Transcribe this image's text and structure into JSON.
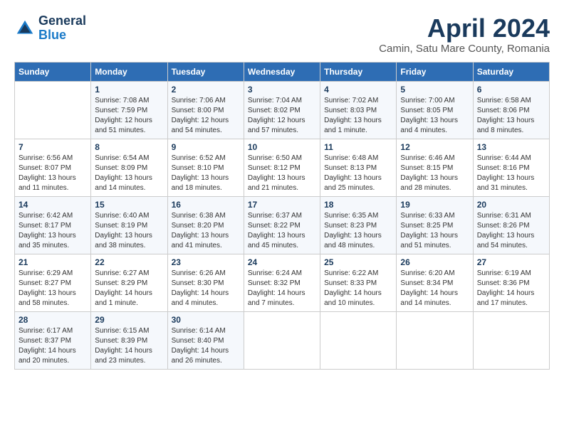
{
  "header": {
    "logo_general": "General",
    "logo_blue": "Blue",
    "month_title": "April 2024",
    "location": "Camin, Satu Mare County, Romania"
  },
  "weekdays": [
    "Sunday",
    "Monday",
    "Tuesday",
    "Wednesday",
    "Thursday",
    "Friday",
    "Saturday"
  ],
  "weeks": [
    [
      {
        "day": "",
        "sunrise": "",
        "sunset": "",
        "daylight": ""
      },
      {
        "day": "1",
        "sunrise": "Sunrise: 7:08 AM",
        "sunset": "Sunset: 7:59 PM",
        "daylight": "Daylight: 12 hours and 51 minutes."
      },
      {
        "day": "2",
        "sunrise": "Sunrise: 7:06 AM",
        "sunset": "Sunset: 8:00 PM",
        "daylight": "Daylight: 12 hours and 54 minutes."
      },
      {
        "day": "3",
        "sunrise": "Sunrise: 7:04 AM",
        "sunset": "Sunset: 8:02 PM",
        "daylight": "Daylight: 12 hours and 57 minutes."
      },
      {
        "day": "4",
        "sunrise": "Sunrise: 7:02 AM",
        "sunset": "Sunset: 8:03 PM",
        "daylight": "Daylight: 13 hours and 1 minute."
      },
      {
        "day": "5",
        "sunrise": "Sunrise: 7:00 AM",
        "sunset": "Sunset: 8:05 PM",
        "daylight": "Daylight: 13 hours and 4 minutes."
      },
      {
        "day": "6",
        "sunrise": "Sunrise: 6:58 AM",
        "sunset": "Sunset: 8:06 PM",
        "daylight": "Daylight: 13 hours and 8 minutes."
      }
    ],
    [
      {
        "day": "7",
        "sunrise": "Sunrise: 6:56 AM",
        "sunset": "Sunset: 8:07 PM",
        "daylight": "Daylight: 13 hours and 11 minutes."
      },
      {
        "day": "8",
        "sunrise": "Sunrise: 6:54 AM",
        "sunset": "Sunset: 8:09 PM",
        "daylight": "Daylight: 13 hours and 14 minutes."
      },
      {
        "day": "9",
        "sunrise": "Sunrise: 6:52 AM",
        "sunset": "Sunset: 8:10 PM",
        "daylight": "Daylight: 13 hours and 18 minutes."
      },
      {
        "day": "10",
        "sunrise": "Sunrise: 6:50 AM",
        "sunset": "Sunset: 8:12 PM",
        "daylight": "Daylight: 13 hours and 21 minutes."
      },
      {
        "day": "11",
        "sunrise": "Sunrise: 6:48 AM",
        "sunset": "Sunset: 8:13 PM",
        "daylight": "Daylight: 13 hours and 25 minutes."
      },
      {
        "day": "12",
        "sunrise": "Sunrise: 6:46 AM",
        "sunset": "Sunset: 8:15 PM",
        "daylight": "Daylight: 13 hours and 28 minutes."
      },
      {
        "day": "13",
        "sunrise": "Sunrise: 6:44 AM",
        "sunset": "Sunset: 8:16 PM",
        "daylight": "Daylight: 13 hours and 31 minutes."
      }
    ],
    [
      {
        "day": "14",
        "sunrise": "Sunrise: 6:42 AM",
        "sunset": "Sunset: 8:17 PM",
        "daylight": "Daylight: 13 hours and 35 minutes."
      },
      {
        "day": "15",
        "sunrise": "Sunrise: 6:40 AM",
        "sunset": "Sunset: 8:19 PM",
        "daylight": "Daylight: 13 hours and 38 minutes."
      },
      {
        "day": "16",
        "sunrise": "Sunrise: 6:38 AM",
        "sunset": "Sunset: 8:20 PM",
        "daylight": "Daylight: 13 hours and 41 minutes."
      },
      {
        "day": "17",
        "sunrise": "Sunrise: 6:37 AM",
        "sunset": "Sunset: 8:22 PM",
        "daylight": "Daylight: 13 hours and 45 minutes."
      },
      {
        "day": "18",
        "sunrise": "Sunrise: 6:35 AM",
        "sunset": "Sunset: 8:23 PM",
        "daylight": "Daylight: 13 hours and 48 minutes."
      },
      {
        "day": "19",
        "sunrise": "Sunrise: 6:33 AM",
        "sunset": "Sunset: 8:25 PM",
        "daylight": "Daylight: 13 hours and 51 minutes."
      },
      {
        "day": "20",
        "sunrise": "Sunrise: 6:31 AM",
        "sunset": "Sunset: 8:26 PM",
        "daylight": "Daylight: 13 hours and 54 minutes."
      }
    ],
    [
      {
        "day": "21",
        "sunrise": "Sunrise: 6:29 AM",
        "sunset": "Sunset: 8:27 PM",
        "daylight": "Daylight: 13 hours and 58 minutes."
      },
      {
        "day": "22",
        "sunrise": "Sunrise: 6:27 AM",
        "sunset": "Sunset: 8:29 PM",
        "daylight": "Daylight: 14 hours and 1 minute."
      },
      {
        "day": "23",
        "sunrise": "Sunrise: 6:26 AM",
        "sunset": "Sunset: 8:30 PM",
        "daylight": "Daylight: 14 hours and 4 minutes."
      },
      {
        "day": "24",
        "sunrise": "Sunrise: 6:24 AM",
        "sunset": "Sunset: 8:32 PM",
        "daylight": "Daylight: 14 hours and 7 minutes."
      },
      {
        "day": "25",
        "sunrise": "Sunrise: 6:22 AM",
        "sunset": "Sunset: 8:33 PM",
        "daylight": "Daylight: 14 hours and 10 minutes."
      },
      {
        "day": "26",
        "sunrise": "Sunrise: 6:20 AM",
        "sunset": "Sunset: 8:34 PM",
        "daylight": "Daylight: 14 hours and 14 minutes."
      },
      {
        "day": "27",
        "sunrise": "Sunrise: 6:19 AM",
        "sunset": "Sunset: 8:36 PM",
        "daylight": "Daylight: 14 hours and 17 minutes."
      }
    ],
    [
      {
        "day": "28",
        "sunrise": "Sunrise: 6:17 AM",
        "sunset": "Sunset: 8:37 PM",
        "daylight": "Daylight: 14 hours and 20 minutes."
      },
      {
        "day": "29",
        "sunrise": "Sunrise: 6:15 AM",
        "sunset": "Sunset: 8:39 PM",
        "daylight": "Daylight: 14 hours and 23 minutes."
      },
      {
        "day": "30",
        "sunrise": "Sunrise: 6:14 AM",
        "sunset": "Sunset: 8:40 PM",
        "daylight": "Daylight: 14 hours and 26 minutes."
      },
      {
        "day": "",
        "sunrise": "",
        "sunset": "",
        "daylight": ""
      },
      {
        "day": "",
        "sunrise": "",
        "sunset": "",
        "daylight": ""
      },
      {
        "day": "",
        "sunrise": "",
        "sunset": "",
        "daylight": ""
      },
      {
        "day": "",
        "sunrise": "",
        "sunset": "",
        "daylight": ""
      }
    ]
  ]
}
